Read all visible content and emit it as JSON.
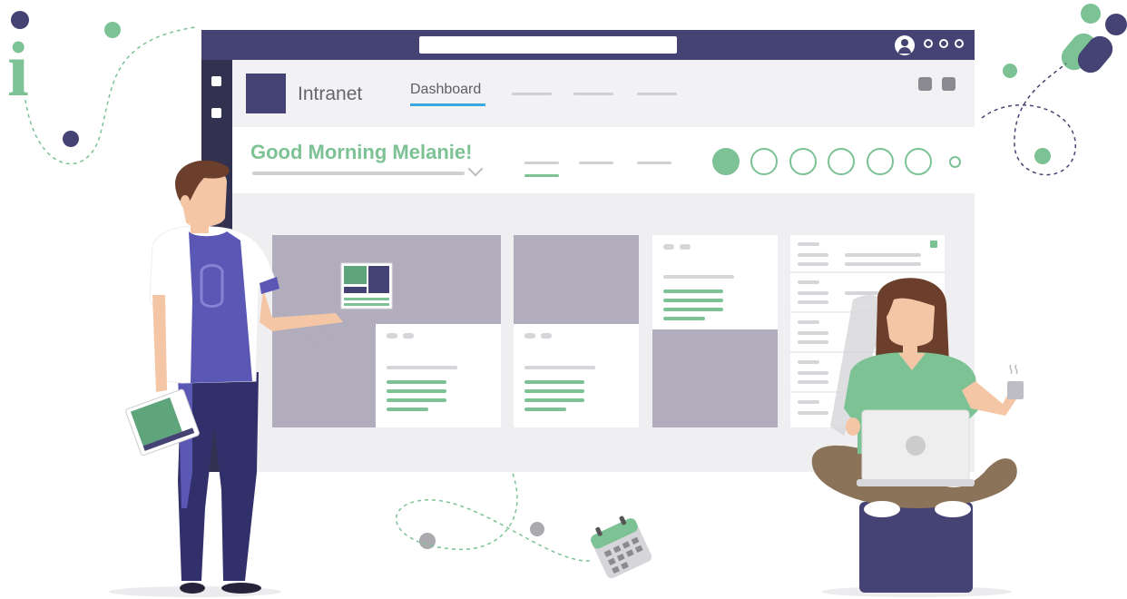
{
  "app": {
    "brand": "Intranet",
    "active_tab": "Dashboard",
    "greeting": "Good Morning Melanie!"
  },
  "decorations": {
    "info_glyph": "i",
    "icons": [
      "info-icon",
      "calendar-icon",
      "pill-icon",
      "user-icon",
      "tablet-icon",
      "laptop-icon",
      "mug-icon",
      "team-icon"
    ]
  },
  "colors": {
    "primary": "#454373",
    "accent_green": "#7cc295",
    "tab_underline": "#3ba7e0",
    "card_gray": "#b1adbd",
    "rail": "#32314f"
  }
}
